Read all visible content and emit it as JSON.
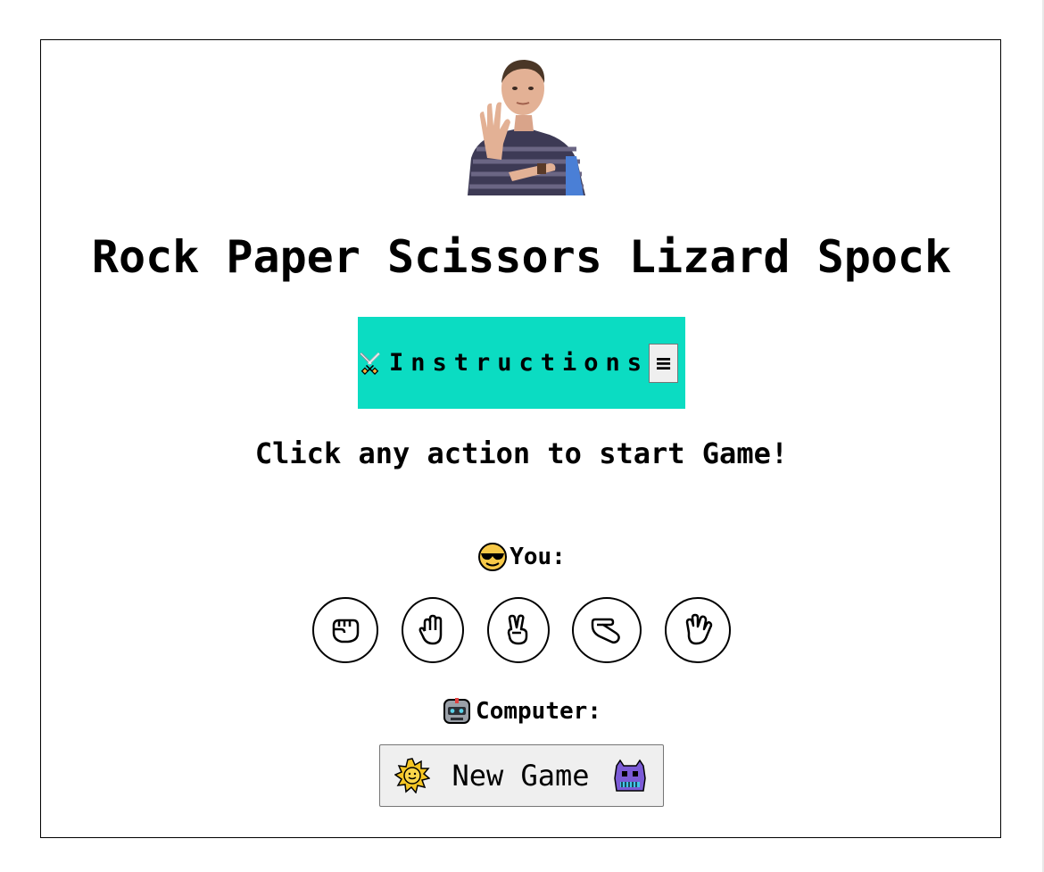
{
  "header": {
    "title": "Rock Paper Scissors Lizard Spock",
    "avatar_icon": "sheldon-vulcan-salute-photo"
  },
  "instructions": {
    "label": "Instructions",
    "icon": "crossed-swords-icon",
    "menu_glyph": "≡",
    "background": "#0bdcc2"
  },
  "prompt": "Click any action to start Game!",
  "player": {
    "label": "You:",
    "icon": "sunglasses-face-icon",
    "actions": [
      {
        "name": "rock",
        "icon": "raised-fist-icon"
      },
      {
        "name": "paper",
        "icon": "raised-hand-icon"
      },
      {
        "name": "scissors",
        "icon": "victory-hand-icon"
      },
      {
        "name": "lizard",
        "icon": "lizard-hand-icon"
      },
      {
        "name": "spock",
        "icon": "vulcan-salute-icon"
      }
    ]
  },
  "computer": {
    "label": "Computer:",
    "icon": "robot-face-icon"
  },
  "new_game": {
    "label": "New Game",
    "left_icon": "sun-icon",
    "right_icon": "alien-monster-icon"
  }
}
